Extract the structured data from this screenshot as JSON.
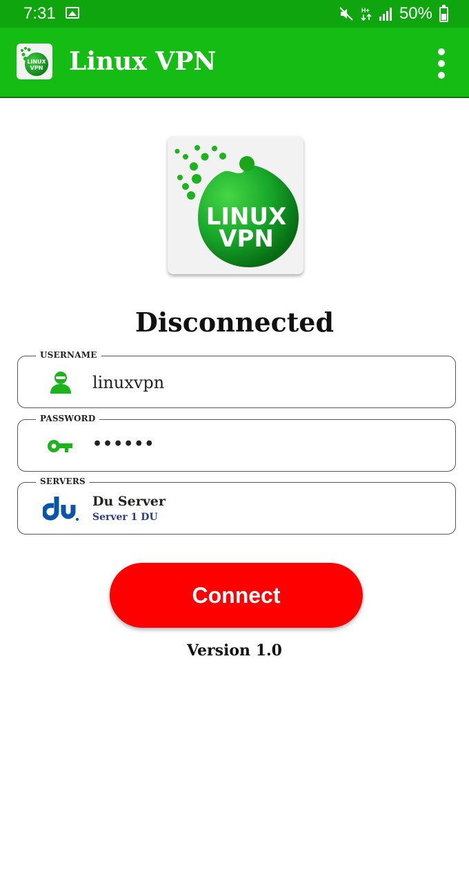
{
  "status_bar": {
    "time": "7:31",
    "battery": "50%"
  },
  "app_bar": {
    "title": "Linux VPN",
    "icon_text_line1": "LINUX",
    "icon_text_line2": "VPN"
  },
  "logo": {
    "line1": "LINUX",
    "line2": "VPN"
  },
  "connection_status": "Disconnected",
  "username": {
    "label": "USERNAME",
    "value": "linuxvpn"
  },
  "password": {
    "label": "PASSWORD",
    "value": "••••••"
  },
  "servers": {
    "label": "SERVERS",
    "name": "Du Server",
    "subtitle": "Server 1 DU"
  },
  "connect_button": "Connect",
  "version": "Version 1.0",
  "colors": {
    "status_bar": "#0ea50e",
    "app_bar": "#14bc14",
    "accent_green": "#1db31d",
    "connect_red": "#ff0000",
    "du_blue": "#0a55a8"
  }
}
